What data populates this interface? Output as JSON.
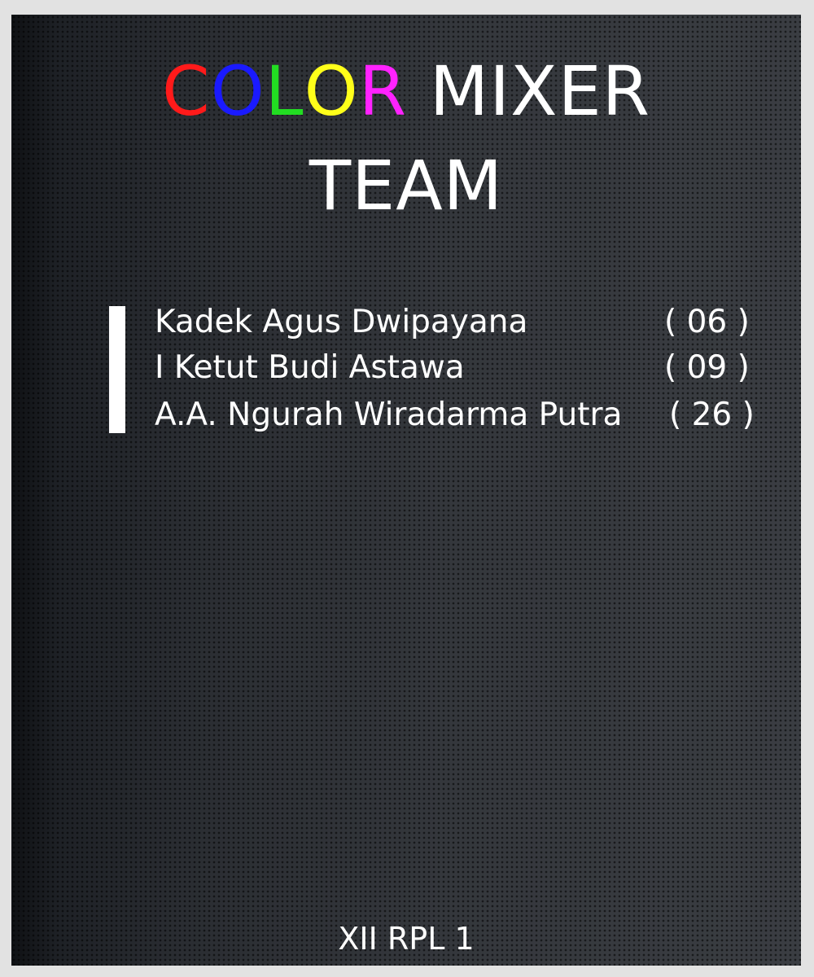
{
  "title": {
    "color_letters": [
      {
        "char": "C",
        "color": "#ff1a1a"
      },
      {
        "char": "O",
        "color": "#1a1aff"
      },
      {
        "char": "L",
        "color": "#22dd22"
      },
      {
        "char": "O",
        "color": "#ffff1a"
      },
      {
        "char": "R",
        "color": "#ff22ff"
      }
    ],
    "word2": "MIXER",
    "line2": "TEAM"
  },
  "members": [
    {
      "name": "Kadek Agus Dwipayana",
      "number": "( 06 )"
    },
    {
      "name": "I Ketut Budi Astawa",
      "number": "( 09 )"
    },
    {
      "name": "A.A. Ngurah Wiradarma Putra",
      "number": "( 26 )"
    }
  ],
  "footer": {
    "class_label": "XII RPL 1"
  },
  "colors": {
    "background": "#2b2e33",
    "text": "#ffffff",
    "page": "#e2e2e2"
  }
}
